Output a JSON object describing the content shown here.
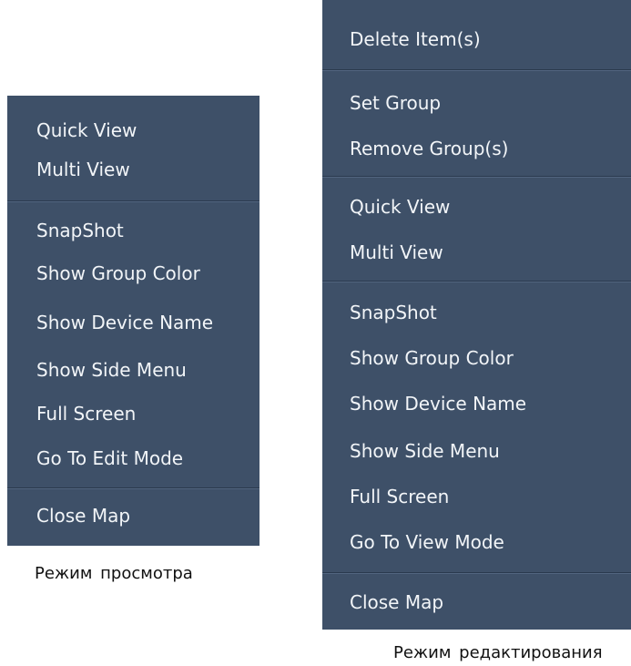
{
  "view_menu": {
    "items": [
      "Quick View",
      "Multi View",
      "SnapShot",
      "Show Group Color",
      "Show Device Name",
      "Show Side Menu",
      "Full Screen",
      "Go To Edit Mode",
      "Close Map"
    ],
    "caption": "Режим просмотра"
  },
  "edit_menu": {
    "items": [
      "Delete Item(s)",
      "Set Group",
      "Remove Group(s)",
      "Quick View",
      "Multi View",
      "SnapShot",
      "Show Group Color",
      "Show Device Name",
      "Show Side Menu",
      "Full Screen",
      "Go To View Mode",
      "Close Map"
    ],
    "caption": "Режим редактирования"
  },
  "colors": {
    "menu_background": "#3e5068",
    "menu_text": "#f2f5f8",
    "separator": "#2a3a4e"
  }
}
